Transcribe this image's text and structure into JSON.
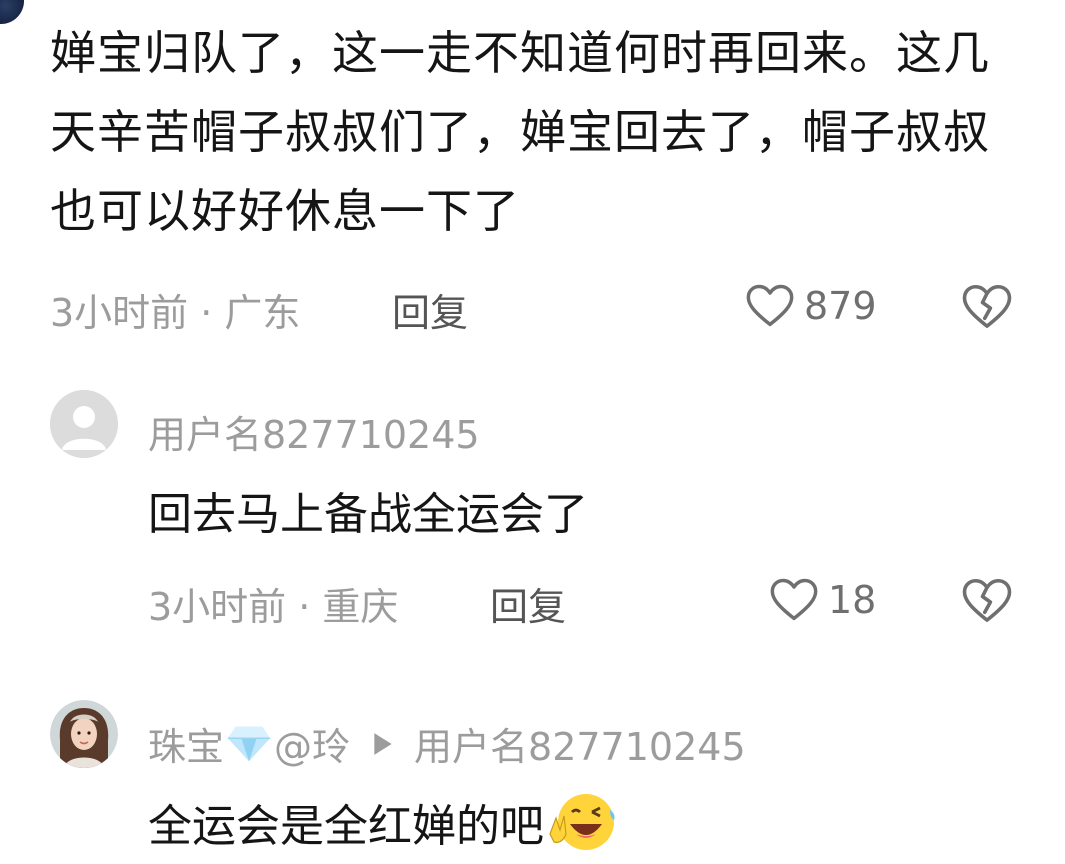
{
  "top_comment": {
    "text": "婵宝归队了，这一走不知道何时再回来。这几天辛苦帽子叔叔们了，婵宝回去了，帽子叔叔也可以好好休息一下了",
    "time_location": "3小时前 · 广东",
    "reply_label": "回复",
    "like_count": "879"
  },
  "replies": [
    {
      "username": "用户名827710245",
      "text": "回去马上备战全运会了",
      "time_location": "3小时前 · 重庆",
      "reply_label": "回复",
      "like_count": "18"
    },
    {
      "username_part1": "珠宝",
      "username_part2": "@玲",
      "reply_to": "用户名827710245",
      "text": "全运会是全红婵的吧"
    }
  ],
  "icons": {
    "like": "heart-outline-icon",
    "dislike": "broken-heart-icon",
    "default_avatar": "default-avatar-icon",
    "diamond": "diamond-emoji-icon",
    "reply_arrow": "play-triangle-icon",
    "emoji": "winking-laughing-emoji-icon"
  },
  "colors": {
    "text_primary": "#151515",
    "text_meta": "#9c9c9c",
    "reply_button": "#555555"
  }
}
